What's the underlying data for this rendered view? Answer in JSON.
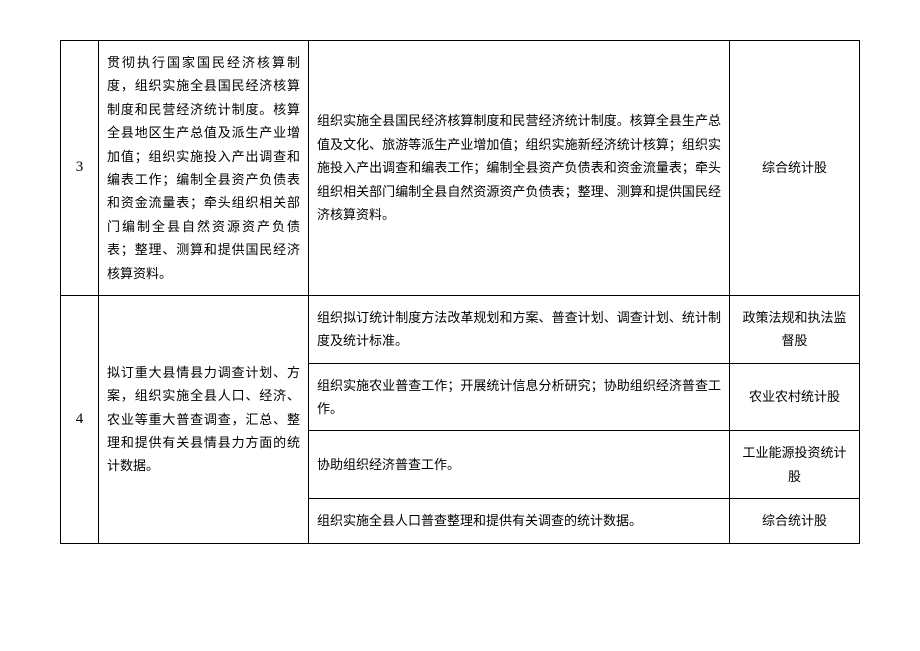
{
  "rows": [
    {
      "num": "3",
      "desc": "贯彻执行国家国民经济核算制度，组织实施全县国民经济核算制度和民营经济统计制度。核算全县地区生产总值及派生产业增加值；组织实施投入产出调查和编表工作；编制全县资产负债表和资金流量表；牵头组织相关部门编制全县自然资源资产负债表；整理、测算和提供国民经济核算资料。",
      "detail": "组织实施全县国民经济核算制度和民营经济统计制度。核算全县生产总值及文化、旅游等派生产业增加值；组织实施新经济统计核算；组织实施投入产出调查和编表工作；编制全县资产负债表和资金流量表；牵头组织相关部门编制全县自然资源资产负债表；整理、测算和提供国民经济核算资料。",
      "dept": "综合统计股"
    },
    {
      "num": "4",
      "desc": "拟订重大县情县力调查计划、方案，组织实施全县人口、经济、农业等重大普查调查，汇总、整理和提供有关县情县力方面的统计数据。",
      "sub": [
        {
          "detail": "组织拟订统计制度方法改革规划和方案、普查计划、调查计划、统计制度及统计标准。",
          "dept": "政策法规和执法监督股"
        },
        {
          "detail": "组织实施农业普查工作；开展统计信息分析研究；协助组织经济普查工作。",
          "dept": "农业农村统计股"
        },
        {
          "detail": "协助组织经济普查工作。",
          "dept": "工业能源投资统计股"
        },
        {
          "detail": "组织实施全县人口普查整理和提供有关调查的统计数据。",
          "dept": "综合统计股"
        }
      ]
    }
  ]
}
